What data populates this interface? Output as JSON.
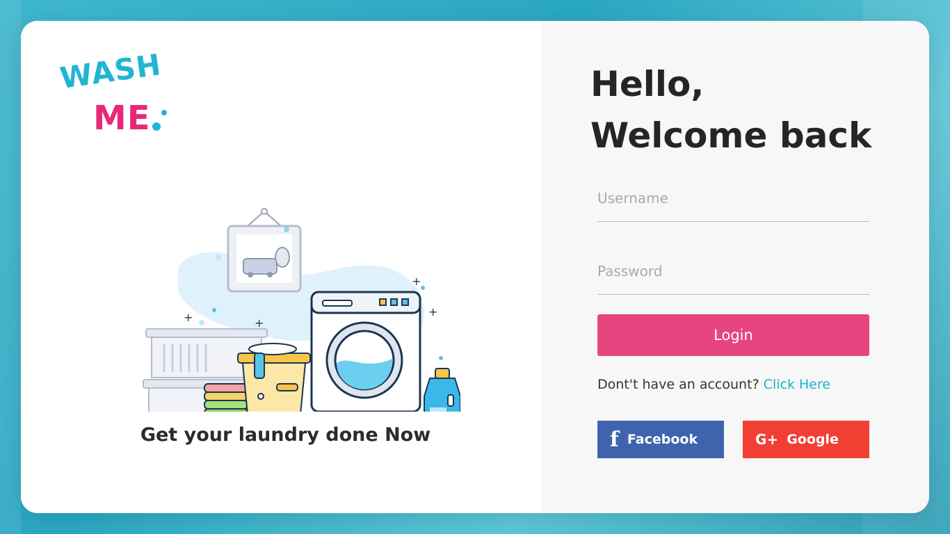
{
  "logo": {
    "line1": "WASH",
    "line2": "ME"
  },
  "left": {
    "tagline": "Get your laundry done Now"
  },
  "greeting": {
    "line1": "Hello,",
    "line2": "Welcome back"
  },
  "form": {
    "username_placeholder": "Username",
    "password_placeholder": "Password",
    "login_label": "Login",
    "signup_prompt": "Dont't have an account?",
    "signup_link": "Click Here"
  },
  "social": {
    "facebook_label": "Facebook",
    "facebook_icon": "facebook-icon",
    "google_label": "Google",
    "google_icon": "google-plus-icon"
  },
  "colors": {
    "brand_cyan": "#22b5d3",
    "brand_pink": "#e8297a",
    "login_button": "#e7457f",
    "facebook": "#3f64ad",
    "google": "#f23f34",
    "link": "#19b4cf"
  }
}
